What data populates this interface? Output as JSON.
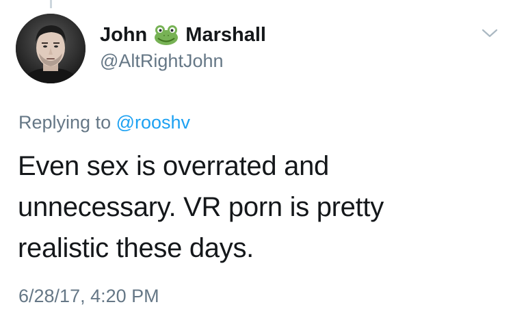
{
  "author": {
    "name_first": "John",
    "name_last": "Marshall",
    "name_emoji": "frog-face-emoji",
    "handle": "@AltRightJohn"
  },
  "reply_context": {
    "prefix": "Replying to",
    "mention": "@rooshv"
  },
  "tweet": {
    "lines": [
      "Even sex is overrated and",
      "unnecessary. VR porn is pretty",
      "realistic these days."
    ]
  },
  "timestamp": "6/28/17, 4:20 PM",
  "colors": {
    "text_primary": "#14171a",
    "text_secondary": "#657786",
    "link": "#1da1f2",
    "frog_green": "#77b255"
  },
  "icons": {
    "menu_caret": "chevron-down-icon"
  }
}
